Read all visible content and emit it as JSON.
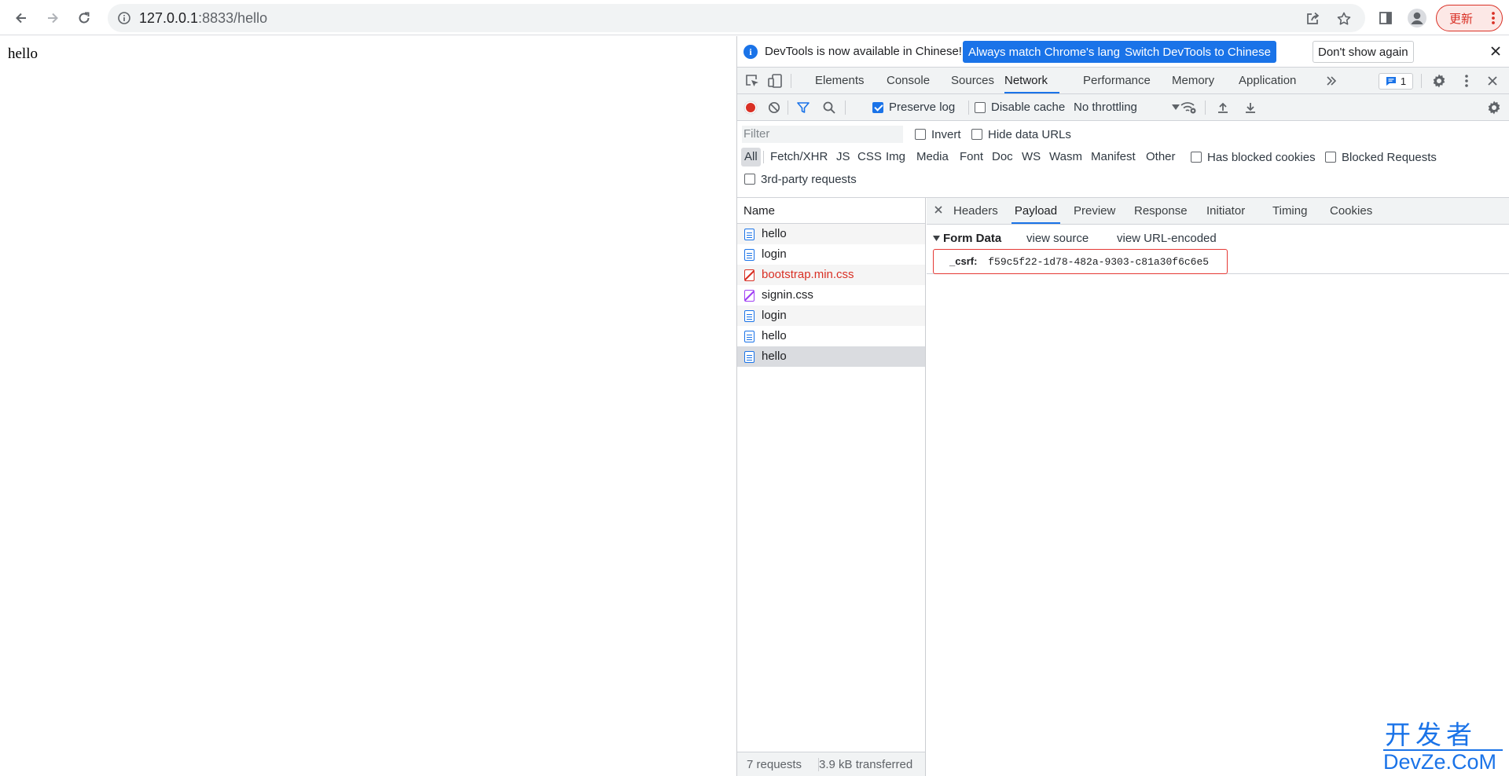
{
  "browser": {
    "url_host": "127.0.0.1",
    "url_path": ":8833/hello",
    "update_label": "更新"
  },
  "page": {
    "body_text": "hello"
  },
  "devtools": {
    "infobar": {
      "message": "DevTools is now available in Chinese!",
      "btn_match": "Always match Chrome's language",
      "btn_switch": "Switch DevTools to Chinese",
      "btn_dismiss": "Don't show again"
    },
    "tabs": [
      "Elements",
      "Console",
      "Sources",
      "Network",
      "Performance",
      "Memory",
      "Application"
    ],
    "active_tab": "Network",
    "issues_count": "1",
    "toolbar": {
      "preserve_log": "Preserve log",
      "disable_cache": "Disable cache",
      "throttling": "No throttling"
    },
    "filter": {
      "placeholder": "Filter",
      "invert": "Invert",
      "hide_data_urls": "Hide data URLs",
      "types": [
        "All",
        "Fetch/XHR",
        "JS",
        "CSS",
        "Img",
        "Media",
        "Font",
        "Doc",
        "WS",
        "Wasm",
        "Manifest",
        "Other"
      ],
      "has_blocked_cookies": "Has blocked cookies",
      "blocked_requests": "Blocked Requests",
      "third_party": "3rd-party requests"
    },
    "requests": {
      "header": "Name",
      "items": [
        {
          "name": "hello",
          "kind": "doc"
        },
        {
          "name": "login",
          "kind": "doc"
        },
        {
          "name": "bootstrap.min.css",
          "kind": "css-error"
        },
        {
          "name": "signin.css",
          "kind": "css"
        },
        {
          "name": "login",
          "kind": "doc"
        },
        {
          "name": "hello",
          "kind": "doc"
        },
        {
          "name": "hello",
          "kind": "doc"
        }
      ],
      "footer_count": "7 requests",
      "footer_transferred": "3.9 kB transferred"
    },
    "detail": {
      "tabs": [
        "Headers",
        "Payload",
        "Preview",
        "Response",
        "Initiator",
        "Timing",
        "Cookies"
      ],
      "active_tab": "Payload",
      "section_title": "Form Data",
      "view_source": "view source",
      "view_url_encoded": "view URL-encoded",
      "form_key": "_csrf:",
      "form_value": "f59c5f22-1d78-482a-9303-c81a30f6c6e5"
    }
  },
  "watermark": {
    "top": "开发者",
    "bottom": "DevZe.CoM"
  },
  "colors": {
    "accent": "#1a73e8",
    "error": "#d93025",
    "record": "#d93025"
  }
}
